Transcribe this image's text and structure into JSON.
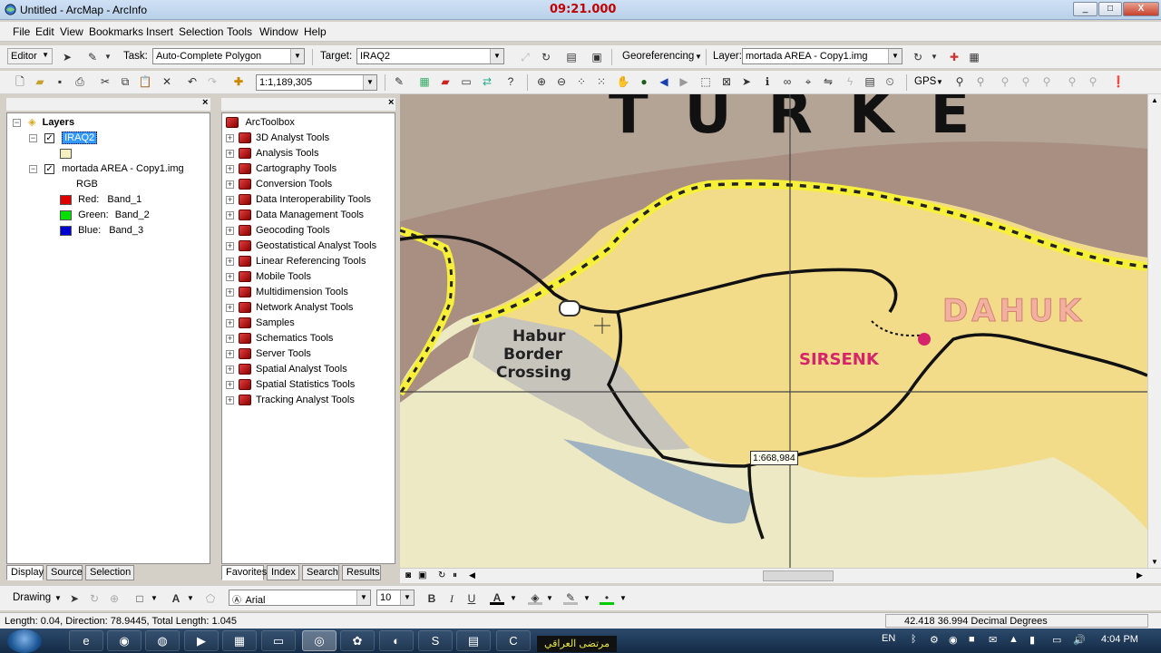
{
  "window": {
    "title": "Untitled - ArcMap - ArcInfo",
    "recording_time": "09:21.000",
    "min_label": "_",
    "max_label": "□",
    "close_label": "X"
  },
  "menu": [
    "File",
    "Edit",
    "View",
    "Bookmarks",
    "Insert",
    "Selection",
    "Tools",
    "Window",
    "Help"
  ],
  "editor_toolbar": {
    "editor_label": "Editor",
    "task_label": "Task:",
    "task_value": "Auto-Complete Polygon",
    "target_label": "Target:",
    "target_value": "IRAQ2",
    "georef_label": "Georeferencing",
    "layer_label": "Layer:",
    "layer_value": "mortada AREA - Copy1.img"
  },
  "standard_toolbar": {
    "scale_value": "1:1,189,305",
    "gps_label": "GPS"
  },
  "toc": {
    "root_label": "Layers",
    "layers": [
      {
        "name": "IRAQ2",
        "checked": true,
        "selected": true
      },
      {
        "name": "mortada AREA - Copy1.img",
        "checked": true,
        "selected": false
      }
    ],
    "rgb_label": "RGB",
    "bands": [
      {
        "label": "Red:",
        "band": "Band_1",
        "color": "#e00000"
      },
      {
        "label": "Green:",
        "band": "Band_2",
        "color": "#00e000"
      },
      {
        "label": "Blue:",
        "band": "Band_3",
        "color": "#0000d0"
      }
    ],
    "iraq2_swatch_color": "#f4f0c0",
    "tabs": [
      "Display",
      "Source",
      "Selection"
    ]
  },
  "toolbox": {
    "root_label": "ArcToolbox",
    "items": [
      "3D Analyst Tools",
      "Analysis Tools",
      "Cartography Tools",
      "Conversion Tools",
      "Data Interoperability Tools",
      "Data Management Tools",
      "Geocoding Tools",
      "Geostatistical Analyst Tools",
      "Linear Referencing Tools",
      "Mobile Tools",
      "Multidimension Tools",
      "Network Analyst Tools",
      "Samples",
      "Schematics Tools",
      "Server Tools",
      "Spatial Analyst Tools",
      "Spatial Statistics Tools",
      "Tracking Analyst Tools"
    ],
    "tabs": [
      "Favorites",
      "Index",
      "Search",
      "Results"
    ]
  },
  "map": {
    "labels": {
      "country": "TURKE",
      "city": "DAHUK",
      "town": "SIRSENK",
      "crossing": [
        "Habur",
        "Border",
        "Crossing"
      ]
    },
    "scale_tip": "1:668,984"
  },
  "drawing_toolbar": {
    "drawing_label": "Drawing",
    "font_name": "Arial",
    "font_size": "10",
    "bold": "B",
    "italic": "I",
    "underline": "U",
    "font_color_glyph": "A"
  },
  "status": {
    "measure_text": "Length: 0.04,  Direction: 78.9445, Total Length: 1.045",
    "coords": "42.418  36.994 Decimal Degrees"
  },
  "taskbar": {
    "lang": "EN",
    "time": "4:04 PM",
    "badge_text": "مرتضى العراقي"
  }
}
